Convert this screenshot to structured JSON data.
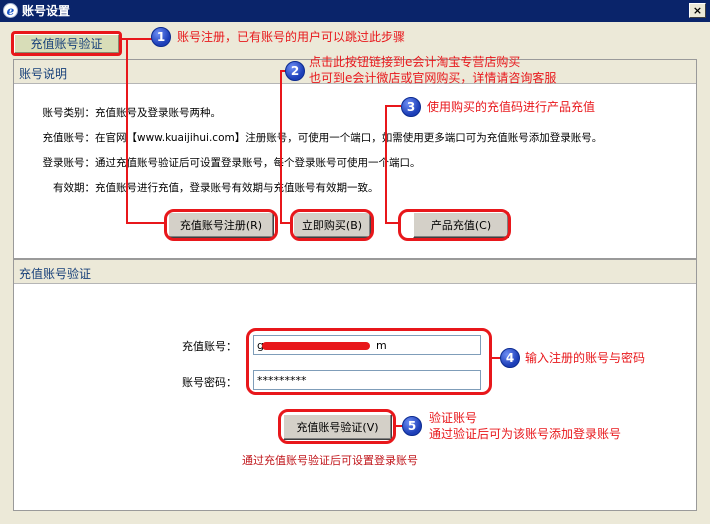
{
  "window": {
    "title": "账号设置",
    "close_glyph": "×",
    "logo_letter": "e"
  },
  "top_button": {
    "label": "充值账号验证"
  },
  "panel1": {
    "title": "账号说明",
    "rows": [
      {
        "label": "账号类别：",
        "text": "充值账号及登录账号两种。"
      },
      {
        "label": "充值账号：",
        "text": "在官网【www.kuaijihui.com】注册账号，可使用一个端口，如需使用更多端口可为充值账号添加登录账号。"
      },
      {
        "label": "登录账号：",
        "text": "通过充值账号验证后可设置登录账号，每个登录账号可使用一个端口。"
      },
      {
        "label": "有效期：",
        "text": "充值账号进行充值，登录账号有效期与充值账号有效期一致。"
      }
    ],
    "buttons": {
      "register": "充值账号注册(R)",
      "buy": "立即购买(B)",
      "recharge": "产品充值(C)"
    }
  },
  "panel2": {
    "title": "充值账号验证",
    "account_label": "充值账号：",
    "account_value": "g",
    "account_suffix": "m",
    "password_label": "账号密码：",
    "password_value": "*********",
    "verify_button": "充值账号验证(V)",
    "hint": "通过充值账号验证后可设置登录账号"
  },
  "annotations": [
    {
      "num": "1",
      "lines": [
        "账号注册，已有账号的用户可以跳过此步骤"
      ]
    },
    {
      "num": "2",
      "lines": [
        "点击此按钮链接到e会计淘宝专营店购买",
        "也可到e会计微店或官网购买，详情请咨询客服"
      ]
    },
    {
      "num": "3",
      "lines": [
        "使用购买的充值码进行产品充值"
      ]
    },
    {
      "num": "4",
      "lines": [
        "输入注册的账号与密码"
      ]
    },
    {
      "num": "5",
      "lines": [
        "验证账号",
        "通过验证后可为该账号添加登录账号"
      ]
    }
  ],
  "colors": {
    "annotation_red": "#e8171b",
    "title_bar": "#0a246a",
    "panel_title": "#17407a"
  }
}
